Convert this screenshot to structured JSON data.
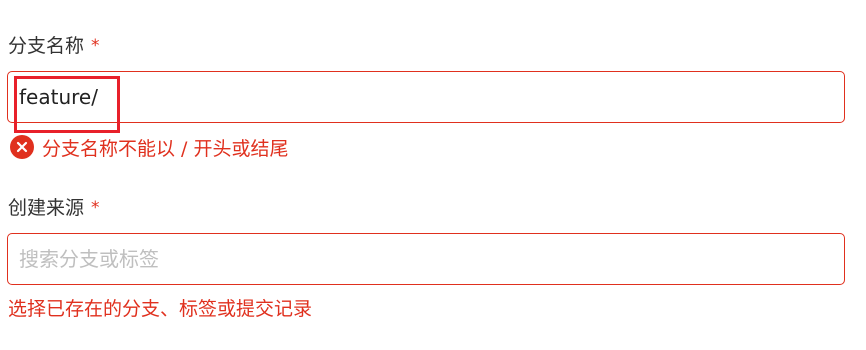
{
  "form": {
    "branch_name": {
      "label": "分支名称",
      "required_mark": "*",
      "value": "feature/",
      "error_icon": "error-circle-icon",
      "error_message": "分支名称不能以 / 开头或结尾"
    },
    "source": {
      "label": "创建来源",
      "required_mark": "*",
      "value": "",
      "placeholder": "搜索分支或标签",
      "hint_message": "选择已存在的分支、标签或提交记录"
    }
  },
  "colors": {
    "error": "#e0301e",
    "highlight": "#e8202a",
    "label": "#333333",
    "placeholder": "#bfbfbf"
  }
}
